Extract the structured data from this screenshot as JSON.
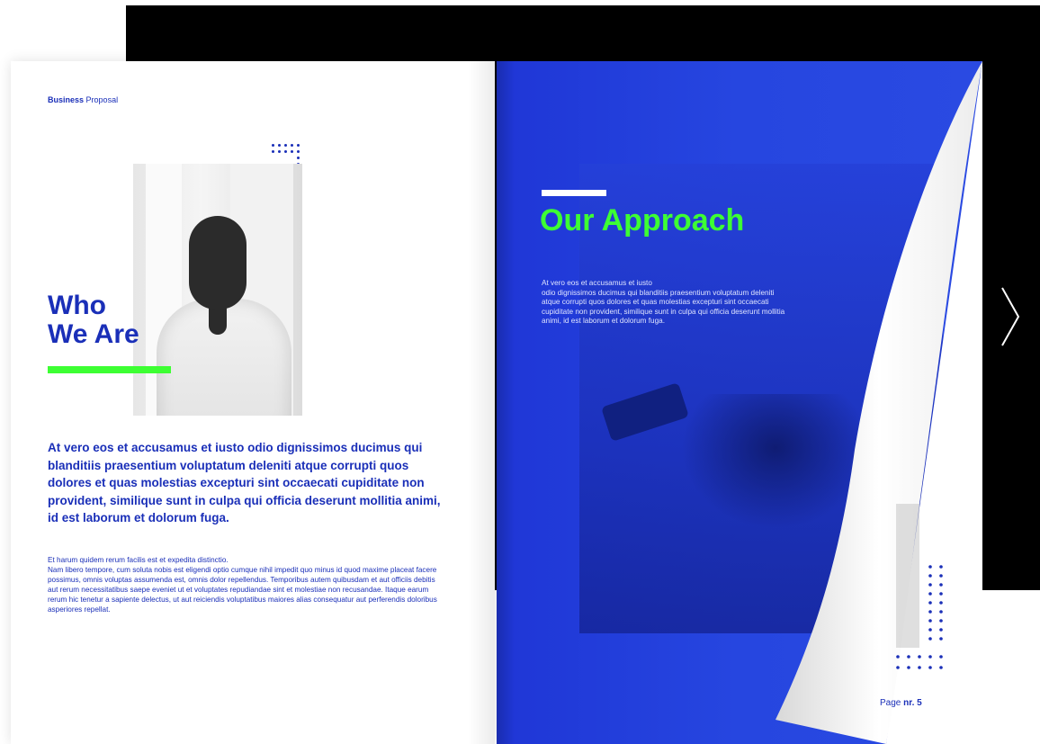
{
  "left_page": {
    "header_bold": "Business",
    "header_rest": "Proposal",
    "title": "Who\nWe Are",
    "lead": "At vero eos et accusamus et iusto odio dignissimos ducimus qui blanditiis praesentium voluptatum deleniti atque corrupti quos dolores et quas molestias excepturi sint occaecati cupiditate non provident, similique sunt in culpa qui officia deserunt mollitia animi, id est laborum et dolorum fuga.",
    "body": "Et harum quidem rerum facilis est et expedita distinctio.\nNam libero tempore, cum soluta nobis est eligendi optio cumque nihil impedit quo minus id quod maxime placeat facere possimus, omnis voluptas assumenda est, omnis dolor repellendus. Temporibus autem quibusdam et aut officiis debitis aut rerum necessitatibus saepe eveniet ut et voluptates repudiandae sint et molestiae non recusandae. Itaque earum rerum hic tenetur a sapiente delectus, ut aut reiciendis voluptatibus maiores alias consequatur aut perferendis doloribus asperiores repellat."
  },
  "right_page": {
    "title": "Our Approach",
    "text": "At vero eos et accusamus et iusto\nodio dignissimos ducimus qui blanditiis praesentium voluptatum deleniti atque corrupti quos dolores et quas molestias excepturi sint occaecati cupiditate non provident, similique sunt in culpa qui officia deserunt mollitia animi, id est laborum et dolorum fuga.",
    "page_label": "Page",
    "page_number": "nr. 5"
  },
  "colors": {
    "brand_blue": "#1a2fb8",
    "page_blue": "#2646e0",
    "accent_green": "#3dff33"
  }
}
